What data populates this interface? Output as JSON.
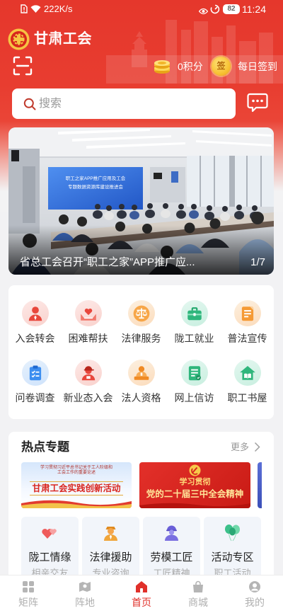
{
  "theme": {
    "brand_red": "#e6392e",
    "active_tab": "#e0302a",
    "text_dark": "#333333",
    "text_gray": "#999999"
  },
  "status_bar": {
    "net_speed": "222K/s",
    "battery": "82",
    "time": "11:24"
  },
  "header": {
    "app_name": "甘肃工会",
    "points": "0积分",
    "checkin_badge": "签",
    "checkin": "每日签到"
  },
  "search": {
    "placeholder": "搜索"
  },
  "banner": {
    "caption": "省总工会召开“职工之家”APP推广应...",
    "counter": "1/7",
    "screen_line_1": "职工之家APP推广应用及工会",
    "screen_line_2": "专题数据资源库建设推进会"
  },
  "services": [
    {
      "label": "入会转会",
      "icon": "join-union-icon"
    },
    {
      "label": "困难帮扶",
      "icon": "helping-hands-icon"
    },
    {
      "label": "法律服务",
      "icon": "scales-icon"
    },
    {
      "label": "陇工就业",
      "icon": "briefcase-icon"
    },
    {
      "label": "普法宣传",
      "icon": "law-document-icon"
    },
    {
      "label": "问卷调查",
      "icon": "clipboard-icon"
    },
    {
      "label": "新业态入会",
      "icon": "courier-icon"
    },
    {
      "label": "法人资格",
      "icon": "legal-person-icon"
    },
    {
      "label": "网上信访",
      "icon": "online-petition-icon"
    },
    {
      "label": "职工书屋",
      "icon": "book-house-icon"
    }
  ],
  "hot_topics": {
    "title": "热点专题",
    "more": "更多",
    "banners": [
      {
        "small_line_1": "学习贯彻习近平总书记关于工人阶级和",
        "small_line_2": "工会工作的重要论述",
        "title": "甘肃工会实践创新活动"
      },
      {
        "line_1": "学习贯彻",
        "line_2": "党的二十届三中全会精神"
      }
    ],
    "cards": [
      {
        "title": "陇工情缘",
        "subtitle": "相亲交友",
        "icon": "hearts-icon"
      },
      {
        "title": "法律援助",
        "subtitle": "专业咨询",
        "icon": "lawyer-icon"
      },
      {
        "title": "劳模工匠",
        "subtitle": "工匠精神",
        "icon": "model-worker-icon"
      },
      {
        "title": "活动专区",
        "subtitle": "职工活动",
        "icon": "balloons-icon"
      }
    ]
  },
  "tab_bar": {
    "items": [
      {
        "label": "矩阵",
        "icon": "matrix-icon",
        "active": false
      },
      {
        "label": "阵地",
        "icon": "position-icon",
        "active": false
      },
      {
        "label": "首页",
        "icon": "home-icon",
        "active": true
      },
      {
        "label": "商城",
        "icon": "shop-icon",
        "active": false
      },
      {
        "label": "我的",
        "icon": "profile-icon",
        "active": false
      }
    ]
  }
}
